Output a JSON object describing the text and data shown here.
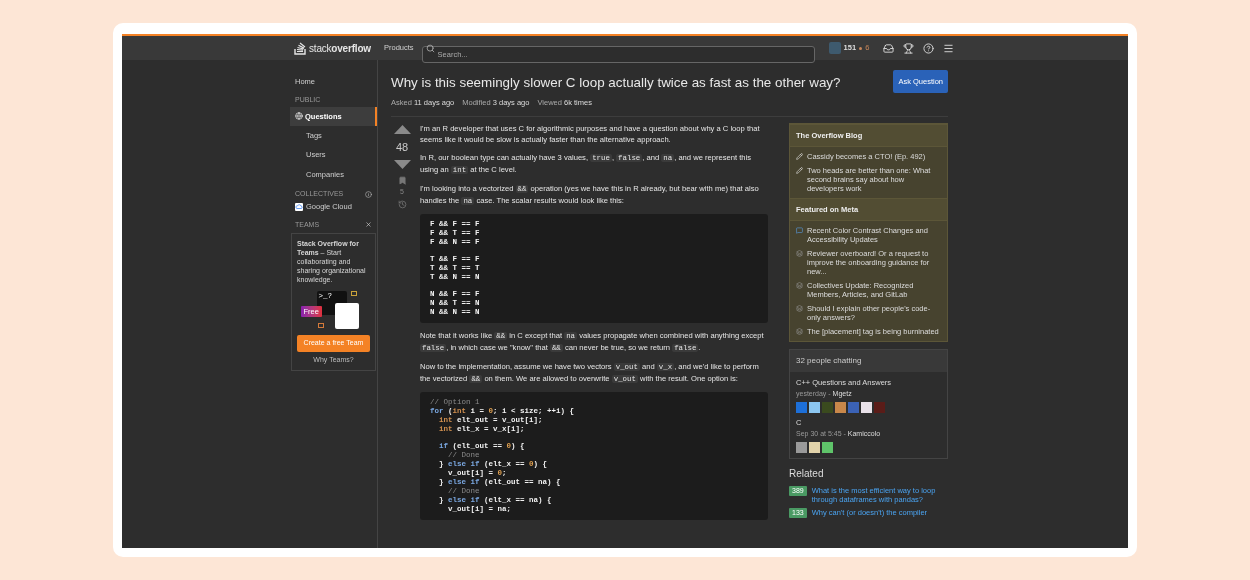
{
  "topbar": {
    "logo": {
      "light": "stack",
      "bold": "overflow"
    },
    "products": "Products",
    "search_placeholder": "Search...",
    "reputation": "151",
    "bronze": "6"
  },
  "sidebar": {
    "home": {
      "label": "Home",
      "selected": false
    },
    "public": {
      "heading": "PUBLIC",
      "items": [
        {
          "kind": "globe",
          "label": "Questions",
          "selected": true
        },
        {
          "kind": "indented",
          "label": "Tags",
          "selected": false
        },
        {
          "kind": "indented",
          "label": "Users",
          "selected": false
        },
        {
          "kind": "indented",
          "label": "Companies",
          "selected": false
        }
      ]
    },
    "collectives": {
      "heading": "COLLECTIVES",
      "items": [
        {
          "label": "Google Cloud"
        }
      ]
    },
    "teams": {
      "heading": "TEAMS",
      "text": "**Stack Overflow for Teams** – Start collaborating and sharing organizational knowledge.",
      "terminal": ">_?",
      "badge": "Free",
      "button": "Create a free Team",
      "link": "Why Teams?"
    }
  },
  "question": {
    "title": "Why is this seemingly slower C loop actually twice as fast as the other way?",
    "ask_button": "Ask Question",
    "meta": [
      {
        "label": "Asked",
        "value": "11 days ago"
      },
      {
        "label": "Modified",
        "value": "3 days ago"
      },
      {
        "label": "Viewed",
        "value": "6k times"
      }
    ],
    "score": "48",
    "bookmarks": "5",
    "body": [
      {
        "kind": "paragraph",
        "parts": [
          {
            "code": false,
            "text": "I'm an R developer that uses C for algorithmic purposes and have a question about why a C loop that seems like it would be slow is actually faster than the alternative approach."
          }
        ]
      },
      {
        "kind": "paragraph",
        "parts": [
          {
            "code": false,
            "text": "In R, our boolean type can actually have 3 values, "
          },
          {
            "code": true,
            "text": "true"
          },
          {
            "code": false,
            "text": ", "
          },
          {
            "code": true,
            "text": "false"
          },
          {
            "code": false,
            "text": ", and "
          },
          {
            "code": true,
            "text": "na"
          },
          {
            "code": false,
            "text": ", and we represent this using an "
          },
          {
            "code": true,
            "text": "int"
          },
          {
            "code": false,
            "text": " at the C level."
          }
        ]
      },
      {
        "kind": "paragraph",
        "parts": [
          {
            "code": false,
            "text": "I'm looking into a vectorized "
          },
          {
            "code": true,
            "text": "&&"
          },
          {
            "code": false,
            "text": " operation (yes we have this in R already, but bear with me) that also handles the "
          },
          {
            "code": true,
            "text": "na"
          },
          {
            "code": false,
            "text": " case. The scalar results would look like this:"
          }
        ]
      },
      {
        "kind": "plain_code",
        "groups": [
          [
            "F && F == F",
            "F && T == F",
            "F && N == F"
          ],
          [
            "T && F == F",
            "T && T == T",
            "T && N == N"
          ],
          [
            "N && F == F",
            "N && T == N",
            "N && N == N"
          ]
        ]
      },
      {
        "kind": "paragraph",
        "parts": [
          {
            "code": false,
            "text": "Note that it works like "
          },
          {
            "code": true,
            "text": "&&"
          },
          {
            "code": false,
            "text": " in C except that "
          },
          {
            "code": true,
            "text": "na"
          },
          {
            "code": false,
            "text": " values propagate when combined with anything except "
          },
          {
            "code": true,
            "text": "false"
          },
          {
            "code": false,
            "text": ", in which case we \"know\" that "
          },
          {
            "code": true,
            "text": "&&"
          },
          {
            "code": false,
            "text": " can never be true, so we return "
          },
          {
            "code": true,
            "text": "false"
          },
          {
            "code": false,
            "text": "."
          }
        ]
      },
      {
        "kind": "paragraph",
        "parts": [
          {
            "code": false,
            "text": "Now to the implementation, assume we have two vectors "
          },
          {
            "code": true,
            "text": "v_out"
          },
          {
            "code": false,
            "text": " and "
          },
          {
            "code": true,
            "text": "v_x"
          },
          {
            "code": false,
            "text": ", and we'd like to perform the vectorized "
          },
          {
            "code": true,
            "text": "&&"
          },
          {
            "code": false,
            "text": " on them. We are allowed to overwrite "
          },
          {
            "code": true,
            "text": "v_out"
          },
          {
            "code": false,
            "text": " with the result. One option is:"
          }
        ]
      },
      {
        "kind": "highlighted_code",
        "groups": [
          [
            [
              {
                "kind": "comment",
                "text": "// Option 1"
              }
            ],
            [
              {
                "kind": "keyword",
                "text": "for"
              },
              {
                "kind": "plain",
                "text": " ("
              },
              {
                "kind": "type",
                "text": "int"
              },
              {
                "kind": "plain",
                "text": " i = "
              },
              {
                "kind": "number",
                "text": "0"
              },
              {
                "kind": "plain",
                "text": "; i < size; ++i) {"
              }
            ],
            [
              {
                "kind": "type",
                "text": "  int"
              },
              {
                "kind": "plain",
                "text": " elt_out = v_out[i];"
              }
            ],
            [
              {
                "kind": "type",
                "text": "  int"
              },
              {
                "kind": "plain",
                "text": " elt_x = v_x[i];"
              }
            ]
          ],
          [
            [
              {
                "kind": "keyword",
                "text": "  if"
              },
              {
                "kind": "plain",
                "text": " (elt_out == "
              },
              {
                "kind": "number",
                "text": "0"
              },
              {
                "kind": "plain",
                "text": ") {"
              }
            ],
            [
              {
                "kind": "comment",
                "text": "    // Done"
              }
            ],
            [
              {
                "kind": "plain",
                "text": "  } "
              },
              {
                "kind": "keyword",
                "text": "else if"
              },
              {
                "kind": "plain",
                "text": " (elt_x == "
              },
              {
                "kind": "number",
                "text": "0"
              },
              {
                "kind": "plain",
                "text": ") {"
              }
            ],
            [
              {
                "kind": "plain",
                "text": "    v_out[i] = "
              },
              {
                "kind": "number",
                "text": "0"
              },
              {
                "kind": "plain",
                "text": ";"
              }
            ],
            [
              {
                "kind": "plain",
                "text": "  } "
              },
              {
                "kind": "keyword",
                "text": "else if"
              },
              {
                "kind": "plain",
                "text": " (elt_out == na) {"
              }
            ],
            [
              {
                "kind": "comment",
                "text": "    // Done"
              }
            ],
            [
              {
                "kind": "plain",
                "text": "  } "
              },
              {
                "kind": "keyword",
                "text": "else if"
              },
              {
                "kind": "plain",
                "text": " (elt_x == na) {"
              }
            ],
            [
              {
                "kind": "plain",
                "text": "    v_out[i] = na;"
              }
            ]
          ]
        ]
      }
    ]
  },
  "blog": {
    "sections": [
      {
        "heading": "The Overflow Blog",
        "items": [
          {
            "kind": "pencil",
            "text": "Cassidy becomes a CTO! (Ep. 492)"
          },
          {
            "kind": "pencil",
            "text": "Two heads are better than one: What second brains say about how developers work"
          }
        ]
      },
      {
        "heading": "Featured on Meta",
        "items": [
          {
            "kind": "chat",
            "text": "Recent Color Contrast Changes and Accessibility Updates"
          },
          {
            "kind": "meta",
            "text": "Reviewer overboard! Or a request to improve the onboarding guidance for new..."
          },
          {
            "kind": "meta",
            "text": "Collectives Update: Recognized Members, Articles, and GitLab"
          },
          {
            "kind": "meta",
            "text": "Should I explain other people's code-only answers?"
          },
          {
            "kind": "meta",
            "text": "The [placement] tag is being burninated"
          }
        ]
      }
    ]
  },
  "chat": {
    "title": "32 people chatting",
    "rooms": [
      {
        "name": "C++ Questions and Answers",
        "time": "yesterday",
        "separator": "-",
        "user": "Mgetz",
        "avatars": [
          {
            "color": "#1d6fd8"
          },
          {
            "color": "#8cc6f0"
          },
          {
            "color": "#3a4a1e"
          },
          {
            "color": "#c8874a"
          },
          {
            "color": "#3b62b5"
          },
          {
            "color": "#e8e0e8"
          },
          {
            "color": "#5a1c18"
          }
        ]
      },
      {
        "name": "C",
        "time": "Sep 30 at 5:45",
        "separator": "-",
        "user": "Kamiccolo",
        "avatars": [
          {
            "color": "#9a9a9a"
          },
          {
            "color": "#e2d3aa"
          },
          {
            "color": "#5fc46a"
          }
        ]
      }
    ]
  },
  "related": {
    "heading": "Related",
    "items": [
      {
        "score": "389",
        "title": "What is the most efficient way to loop through dataframes with pandas?"
      },
      {
        "score": "133",
        "title": "Why can't (or doesn't) the compiler"
      }
    ]
  }
}
